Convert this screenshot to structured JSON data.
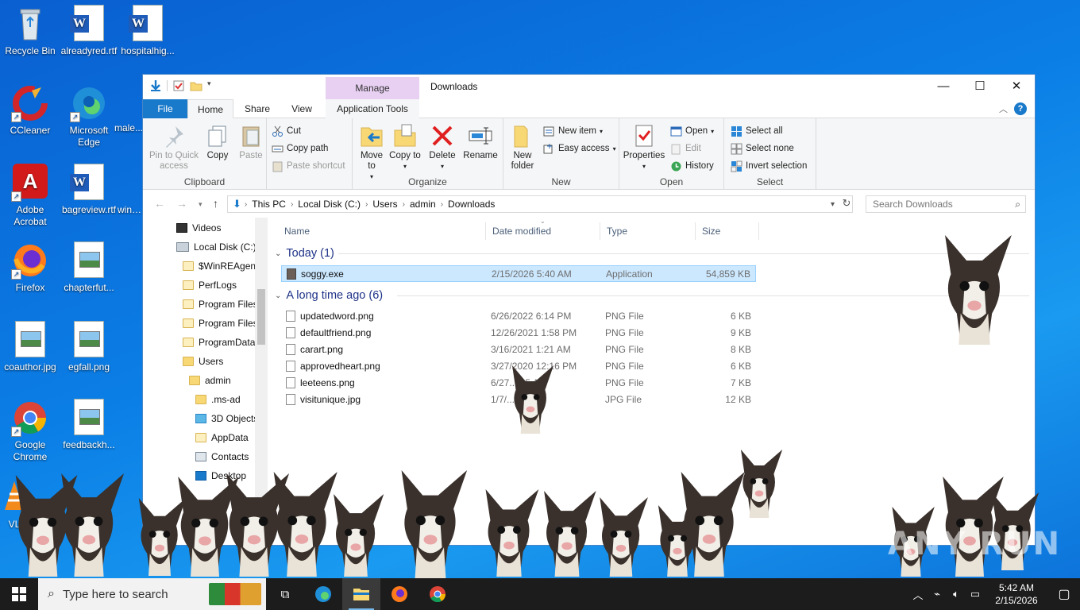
{
  "desktop": {
    "icons": [
      {
        "label": "Recycle Bin"
      },
      {
        "label": "alreadyred.rtf"
      },
      {
        "label": "hospitalhig..."
      },
      {
        "label": "CCleaner"
      },
      {
        "label": "Microsoft Edge"
      },
      {
        "label": "male..."
      },
      {
        "label": "Adobe Acrobat"
      },
      {
        "label": "bagreview.rtf"
      },
      {
        "label": "wine..."
      },
      {
        "label": "Firefox"
      },
      {
        "label": "chapterfut..."
      },
      {
        "label": "coauthor.jpg"
      },
      {
        "label": "egfall.png"
      },
      {
        "label": "Google Chrome"
      },
      {
        "label": "feedbackh..."
      },
      {
        "label": "VL"
      }
    ]
  },
  "window": {
    "title": "Downloads",
    "manage_label": "Manage",
    "tabs": {
      "file": "File",
      "home": "Home",
      "share": "Share",
      "view": "View",
      "apptools": "Application Tools"
    },
    "controls": {
      "minimize": "—",
      "maximize": "☐",
      "close": "✕"
    }
  },
  "ribbon": {
    "clipboard": {
      "title": "Clipboard",
      "pin": "Pin to Quick access",
      "copy": "Copy",
      "paste": "Paste",
      "cut": "Cut",
      "copy_path": "Copy path",
      "paste_shortcut": "Paste shortcut"
    },
    "organize": {
      "title": "Organize",
      "move_to": "Move to",
      "copy_to": "Copy to",
      "delete": "Delete",
      "rename": "Rename"
    },
    "new": {
      "title": "New",
      "new_folder": "New folder",
      "new_item": "New item",
      "easy_access": "Easy access"
    },
    "open": {
      "title": "Open",
      "properties": "Properties",
      "open": "Open",
      "edit": "Edit",
      "history": "History"
    },
    "select": {
      "title": "Select",
      "select_all": "Select all",
      "select_none": "Select none",
      "invert": "Invert selection"
    }
  },
  "address": {
    "crumbs": [
      "This PC",
      "Local Disk (C:)",
      "Users",
      "admin",
      "Downloads"
    ],
    "search_placeholder": "Search Downloads"
  },
  "navpane": {
    "items": [
      "Videos",
      "Local Disk (C:)",
      "$WinREAgent",
      "PerfLogs",
      "Program Files",
      "Program Files",
      "ProgramData",
      "Users",
      "admin",
      ".ms-ad",
      "3D Objects",
      "AppData",
      "Contacts",
      "Desktop"
    ]
  },
  "filelist": {
    "columns": {
      "name": "Name",
      "date": "Date modified",
      "type": "Type",
      "size": "Size"
    },
    "groups": [
      {
        "title": "Today (1)",
        "files": [
          {
            "name": "soggy.exe",
            "date": "2/15/2026 5:40 AM",
            "type": "Application",
            "size": "54,859 KB"
          }
        ]
      },
      {
        "title": "A long time ago (6)",
        "files": [
          {
            "name": "updatedword.png",
            "date": "6/26/2022 6:14 PM",
            "type": "PNG File",
            "size": "6 KB"
          },
          {
            "name": "defaultfriend.png",
            "date": "12/26/2021 1:58 PM",
            "type": "PNG File",
            "size": "9 KB"
          },
          {
            "name": "carart.png",
            "date": "3/16/2021 1:21 AM",
            "type": "PNG File",
            "size": "8 KB"
          },
          {
            "name": "approvedheart.png",
            "date": "3/27/2020 12:16 PM",
            "type": "PNG File",
            "size": "6 KB"
          },
          {
            "name": "leeteens.png",
            "date": "6/27... 35 AM",
            "type": "PNG File",
            "size": "7 KB"
          },
          {
            "name": "visitunique.jpg",
            "date": "1/7/... 5 PM",
            "type": "JPG File",
            "size": "12 KB"
          }
        ]
      }
    ]
  },
  "taskbar": {
    "search_placeholder": "Type here to search",
    "time": "5:42 AM",
    "date": "2/15/2026"
  },
  "watermark": "ANY RUN"
}
